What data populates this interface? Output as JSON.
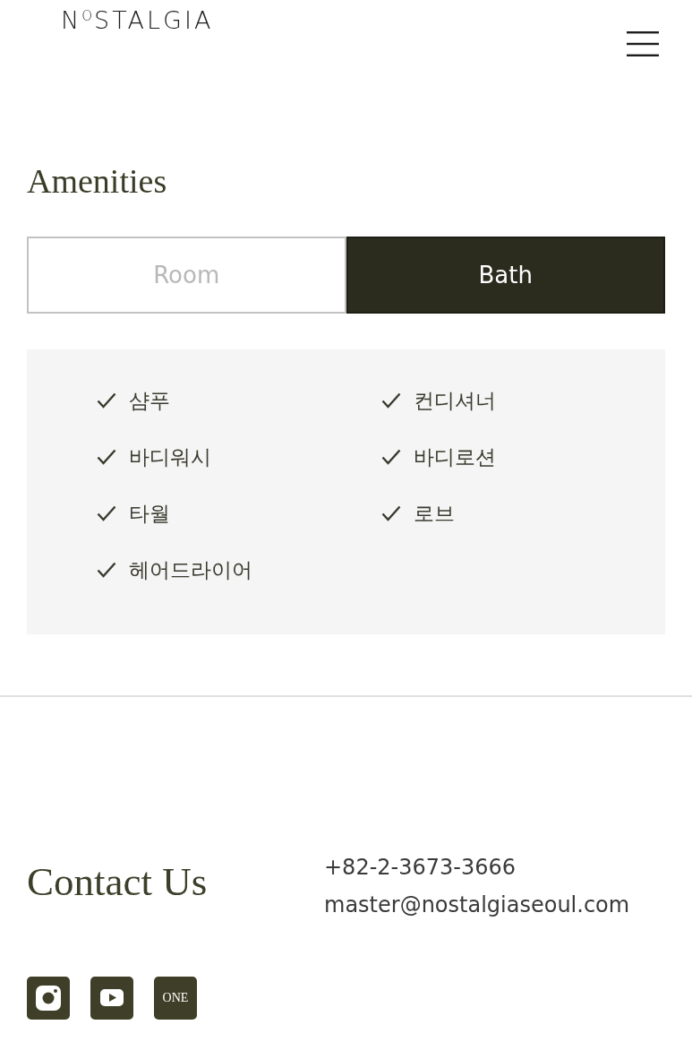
{
  "header": {
    "logo": "N$^{O}$STALGIA"
  },
  "amenities": {
    "title": "Amenities",
    "tabs": [
      {
        "label": "Room",
        "selected": false
      },
      {
        "label": "Bath",
        "selected": true
      }
    ],
    "items": [
      "샴푸",
      "컨디셔너",
      "바디워시",
      "바디로션",
      "타월",
      "로브",
      "헤어드라이어"
    ]
  },
  "contact": {
    "title": "Contact Us",
    "phone": "+82-2-3673-3666",
    "email": "master@nostalgiaseoul.com",
    "social": [
      {
        "kind": "instagram"
      },
      {
        "kind": "youtube"
      },
      {
        "kind": "text",
        "label": "ONE"
      }
    ]
  }
}
